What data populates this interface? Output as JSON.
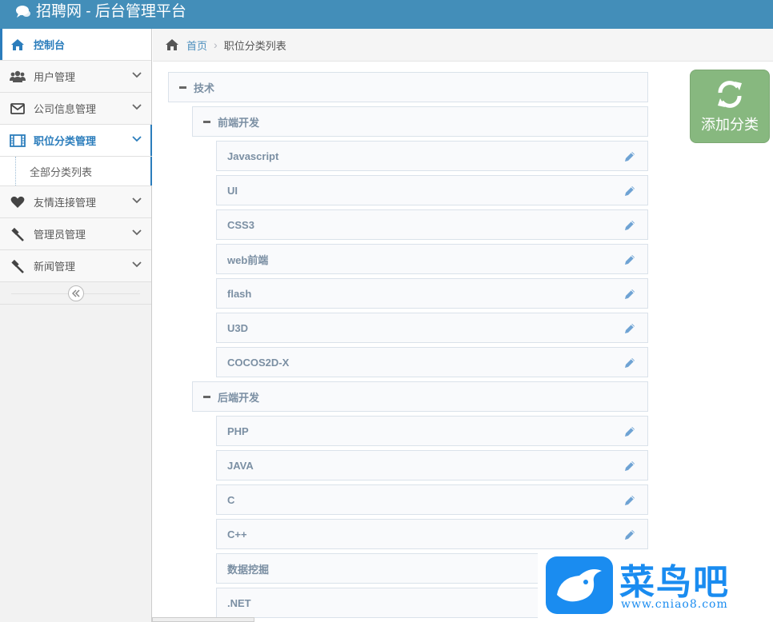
{
  "app": {
    "title": "招聘网 - 后台管理平台"
  },
  "sidebar": {
    "items": [
      {
        "label": "控制台",
        "icon": "home-icon",
        "state": "active"
      },
      {
        "label": "用户管理",
        "icon": "users-icon",
        "state": "normal"
      },
      {
        "label": "公司信息管理",
        "icon": "envelope-icon",
        "state": "normal"
      },
      {
        "label": "职位分类管理",
        "icon": "film-icon",
        "state": "open"
      },
      {
        "label": "友情连接管理",
        "icon": "heart-icon",
        "state": "normal"
      },
      {
        "label": "管理员管理",
        "icon": "gavel-icon",
        "state": "normal"
      },
      {
        "label": "新闻管理",
        "icon": "gavel-icon",
        "state": "normal"
      }
    ],
    "submenu": {
      "label": "全部分类列表"
    }
  },
  "breadcrumb": {
    "home": "首页",
    "current": "职位分类列表"
  },
  "tree": {
    "root": "技术",
    "groups": [
      {
        "label": "前端开发",
        "items": [
          "Javascript",
          "UI",
          "CSS3",
          "web前端",
          "flash",
          "U3D",
          "COCOS2D-X"
        ]
      },
      {
        "label": "后端开发",
        "items": [
          "PHP",
          "JAVA",
          "C",
          "C++",
          "数据挖掘",
          ".NET"
        ]
      }
    ]
  },
  "actions": {
    "add_category": "添加分类"
  },
  "watermark": {
    "title": "菜鸟吧",
    "url": "www.cniao8.com"
  },
  "colors": {
    "header": "#438eb9",
    "accent": "#2b7dbc",
    "add_button": "#87b87f"
  }
}
